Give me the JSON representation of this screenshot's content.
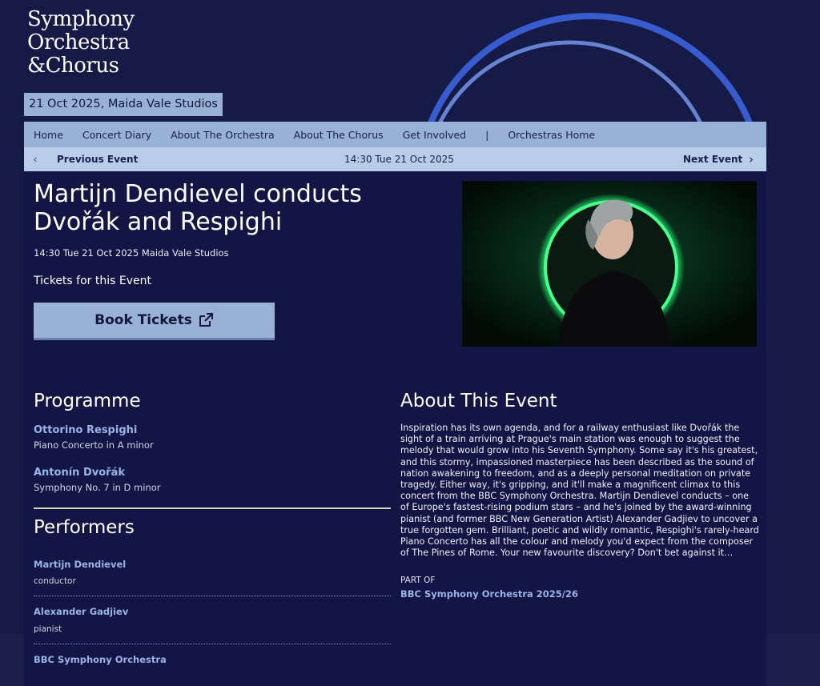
{
  "logo": {
    "lines": [
      "Symphony",
      "Orchestra",
      "&Chorus"
    ]
  },
  "date_venue": "21 Oct 2025, Maida Vale Studios",
  "nav": {
    "items": [
      "Home",
      "Concert Diary",
      "About The Orchestra",
      "About The Chorus",
      "Get Involved",
      "Orchestras Home"
    ],
    "separator": "|"
  },
  "subnav": {
    "prev_icon": "chevron-left-icon",
    "prev_label": "Previous Event",
    "datetime": "14:30 Tue 21 Oct 2025",
    "next_label": "Next Event",
    "next_icon": "chevron-right-icon"
  },
  "event": {
    "title": "Martijn Dendievel conducts Dvořák and Respighi",
    "time_venue": "14:30 Tue 21 Oct 2025 Maida Vale Studios",
    "tickets_label": "Tickets for this Event",
    "book_label": "Book Tickets",
    "book_icon": "external-link-icon"
  },
  "hero_image": {
    "description_icon": "conductor-portrait-image"
  },
  "programme": {
    "heading": "Programme",
    "items": [
      {
        "composer": "Ottorino Respighi",
        "work": "Piano Concerto in A minor"
      },
      {
        "composer": "Antonín Dvořák",
        "work": "Symphony No. 7 in D minor"
      }
    ]
  },
  "performers": {
    "heading": "Performers",
    "items": [
      {
        "name": "Martijn Dendievel",
        "role": "conductor"
      },
      {
        "name": "Alexander Gadjiev",
        "role": "pianist"
      },
      {
        "name": "BBC Symphony Orchestra",
        "role": ""
      }
    ]
  },
  "about": {
    "heading": "About This Event",
    "text": "Inspiration has its own agenda, and for a railway enthusiast like Dvořák the sight of a train arriving at Prague's main station was enough to suggest the melody that would grow into his Seventh Symphony. Some say it's his greatest, and this stormy, impassioned masterpiece has been described as the sound of nation awakening to freedom, and as a deeply personal meditation on private tragedy. Either way, it's gripping, and it'll make a magnificent climax to this concert from the BBC Symphony Orchestra. Martijn Dendievel conducts – one of Europe's fastest-rising podium stars – and he's joined by the award-winning pianist (and former BBC New Generation Artist) Alexander Gadjiev to uncover a true forgotten gem. Brilliant, poetic and wildly romantic, Respighi's rarely-heard Piano Concerto has all the colour and melody you'd expect from the composer of The Pines of Rome. Your new favourite discovery? Don't bet against it…",
    "part_of_label": "PART OF",
    "part_of_link": "BBC Symphony Orchestra 2025/26"
  },
  "colors": {
    "background": "#161a46",
    "panel": "#131545",
    "nav": "#9ab1d6",
    "subnav": "#b8cde8",
    "link": "#9ab4e6",
    "arc": "#3f63d8"
  }
}
